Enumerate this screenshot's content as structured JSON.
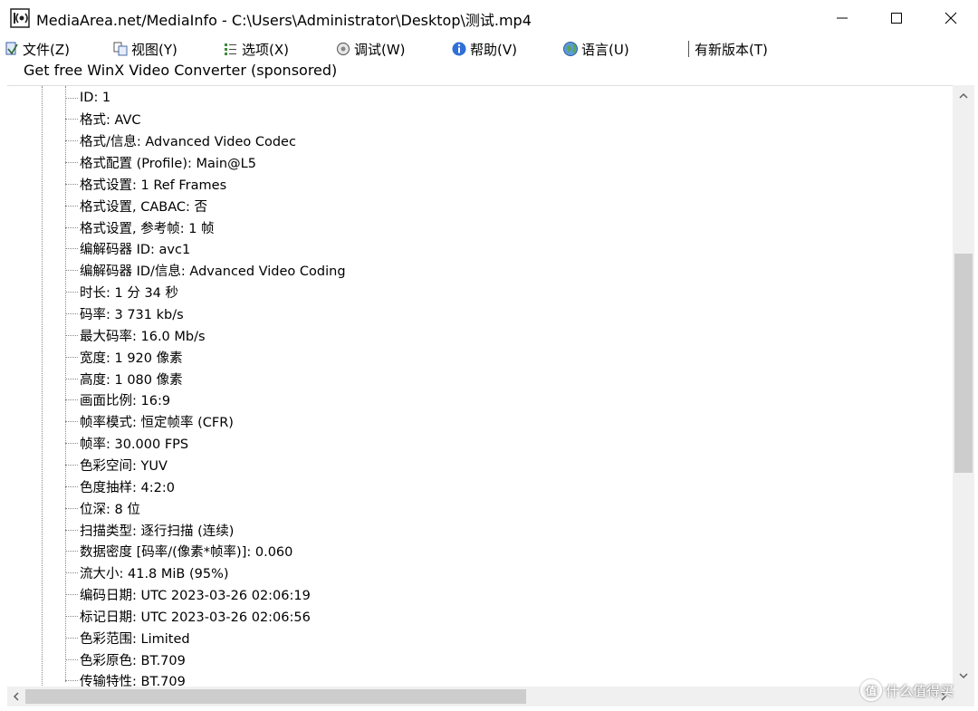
{
  "window": {
    "title": "MediaArea.net/MediaInfo - C:\\Users\\Administrator\\Desktop\\测试.mp4"
  },
  "menu": [
    {
      "label": "文件(Z)",
      "icon": "file-icon"
    },
    {
      "label": "视图(Y)",
      "icon": "view-icon"
    },
    {
      "label": "选项(X)",
      "icon": "options-icon"
    },
    {
      "label": "调试(W)",
      "icon": "debug-icon"
    },
    {
      "label": "帮助(V)",
      "icon": "help-icon"
    },
    {
      "label": "语言(U)",
      "icon": "globe-icon"
    },
    {
      "label": "有新版本(T)",
      "icon": ""
    }
  ],
  "sponsor": "Get free WinX Video Converter (sponsored)",
  "rows": [
    "ID: 1",
    "格式: AVC",
    "格式/信息: Advanced Video Codec",
    "格式配置 (Profile): Main@L5",
    "格式设置: 1 Ref Frames",
    "格式设置, CABAC: 否",
    "格式设置, 参考帧: 1 帧",
    "编解码器 ID: avc1",
    "编解码器 ID/信息: Advanced Video Coding",
    "时长: 1 分 34 秒",
    "码率: 3 731 kb/s",
    "最大码率: 16.0 Mb/s",
    "宽度: 1 920 像素",
    "高度: 1 080 像素",
    "画面比例: 16:9",
    "帧率模式: 恒定帧率 (CFR)",
    "帧率: 30.000 FPS",
    "色彩空间: YUV",
    "色度抽样: 4:2:0",
    "位深: 8 位",
    "扫描类型: 逐行扫描 (连续)",
    "数据密度 [码率/(像素*帧率)]: 0.060",
    "流大小: 41.8 MiB (95%)",
    "编码日期: UTC 2023-03-26 02:06:19",
    "标记日期: UTC 2023-03-26 02:06:56",
    "色彩范围: Limited",
    "色彩原色: BT.709",
    "传输特性: BT.709"
  ],
  "watermark": {
    "badge": "值",
    "text": "什么值得买"
  },
  "colors": {
    "scrollbar_track": "#f0f0f0",
    "scrollbar_thumb": "#cdcdcd",
    "tree_line": "#8a8a8a"
  }
}
